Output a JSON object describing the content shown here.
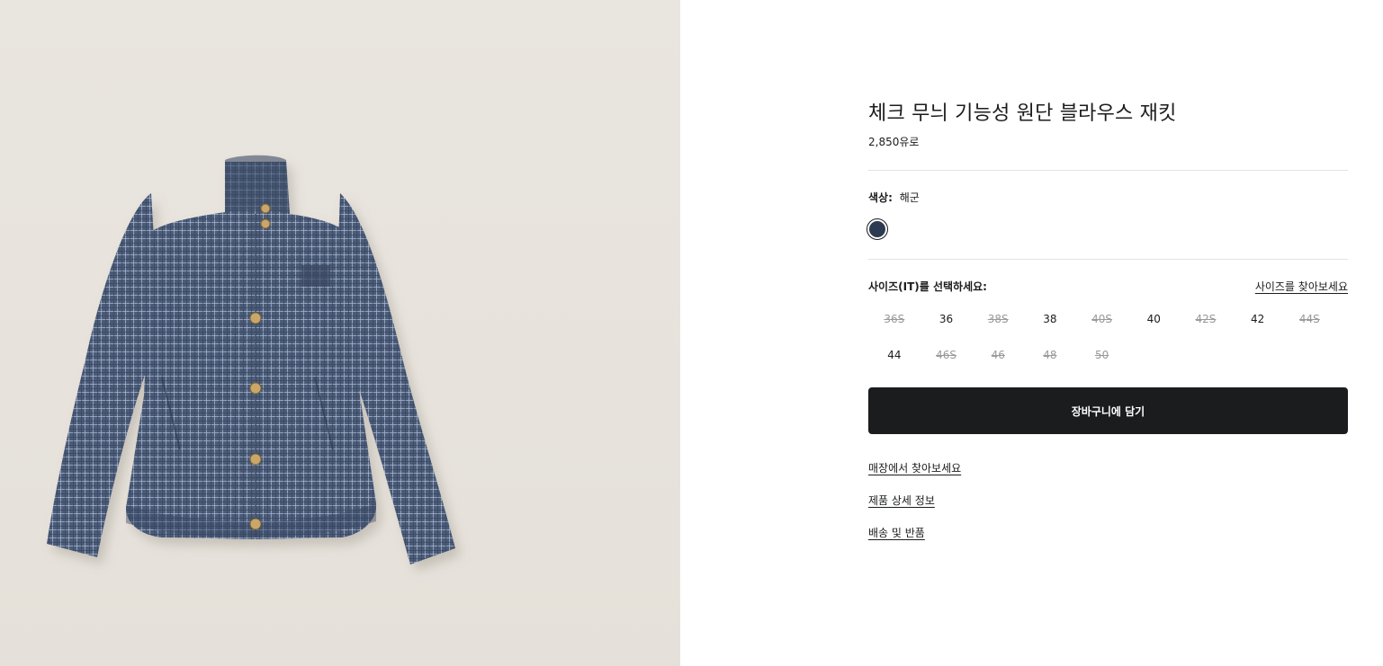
{
  "product": {
    "title": "체크 무늬 기능성 원단 블라우스 재킷",
    "price": "2,850유로",
    "image_alt": "jacket-image"
  },
  "color": {
    "label": "색상:",
    "value": "해군",
    "swatch_color": "#2c3a52"
  },
  "size": {
    "label": "사이즈(IT)를 선택하세요:",
    "guide_link": "사이즈를 찾아보세요",
    "options": [
      {
        "label": "36S",
        "available": false
      },
      {
        "label": "36",
        "available": true
      },
      {
        "label": "38S",
        "available": false
      },
      {
        "label": "38",
        "available": true
      },
      {
        "label": "40S",
        "available": false
      },
      {
        "label": "40",
        "available": true
      },
      {
        "label": "42S",
        "available": false
      },
      {
        "label": "42",
        "available": true
      },
      {
        "label": "44S",
        "available": false
      },
      {
        "label": "44",
        "available": true
      },
      {
        "label": "46S",
        "available": false
      },
      {
        "label": "46",
        "available": false
      },
      {
        "label": "48",
        "available": false
      },
      {
        "label": "50",
        "available": false
      }
    ]
  },
  "cart": {
    "button_label": "장바구니에 담기"
  },
  "links": [
    {
      "label": "매장에서 찾아보세요"
    },
    {
      "label": "제품 상세 정보"
    },
    {
      "label": "배송 및 반품"
    }
  ],
  "colors": {
    "image_background": "#e8e4de",
    "jacket": "#4a5a78",
    "button_dark": "#1b1c1e",
    "unavailable_text": "#9a9a9a"
  }
}
